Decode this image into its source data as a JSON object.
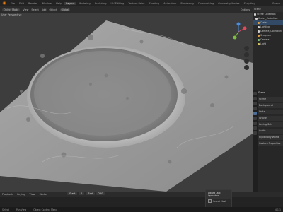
{
  "topbar": {
    "logo": "blender-logo",
    "menus": [
      "File",
      "Edit",
      "Render",
      "Window",
      "Help"
    ],
    "workspaces": [
      "Layout",
      "Modeling",
      "Sculpting",
      "UV Editing",
      "Texture Paint",
      "Shading",
      "Animation",
      "Rendering",
      "Compositing",
      "Geometry Nodes",
      "Scripting"
    ],
    "active_workspace": "Layout",
    "scene_label": "Scene"
  },
  "viewport": {
    "mode": "Object Mode",
    "menus": [
      "View",
      "Select",
      "Add",
      "Object"
    ],
    "transform": "Global",
    "sub_label": "User Perspective",
    "options_label": "Options"
  },
  "outliner": {
    "header": "Scene",
    "rows": [
      {
        "label": "Scene Collection",
        "color": "#d0d0d0",
        "selected": false
      },
      {
        "label": "Crater_Collection",
        "color": "#d0d0d0",
        "selected": false
      },
      {
        "label": "Crater",
        "color": "#e0a040",
        "selected": true
      },
      {
        "label": "Lighting",
        "color": "#d0d0d0",
        "selected": false
      },
      {
        "label": "Camera_Collection",
        "color": "#d0d0d0",
        "selected": false
      },
      {
        "label": "Sculpture",
        "color": "#e0a040",
        "selected": false
      },
      {
        "label": "Camera",
        "color": "#7fbf7f",
        "selected": false
      },
      {
        "label": "Light",
        "color": "#d8c35a",
        "selected": false
      }
    ]
  },
  "properties": {
    "title": "Scene",
    "sections": [
      "Scene",
      "Background",
      "Units",
      "Gravity",
      "Keying Sets",
      "Audio",
      "Rigid Body World",
      "Custom Properties"
    ]
  },
  "timeline": {
    "menus": [
      "Playback",
      "Keying",
      "View",
      "Marker"
    ],
    "start_label": "Start",
    "start": "1",
    "end_label": "End",
    "end": "250"
  },
  "panel": {
    "title": "Adjust Last Operation",
    "option": "Select Most"
  },
  "statusbar": {
    "left": "Select",
    "middle": "Pan View",
    "right": "Object Context Menu",
    "version": "4.1.1"
  }
}
